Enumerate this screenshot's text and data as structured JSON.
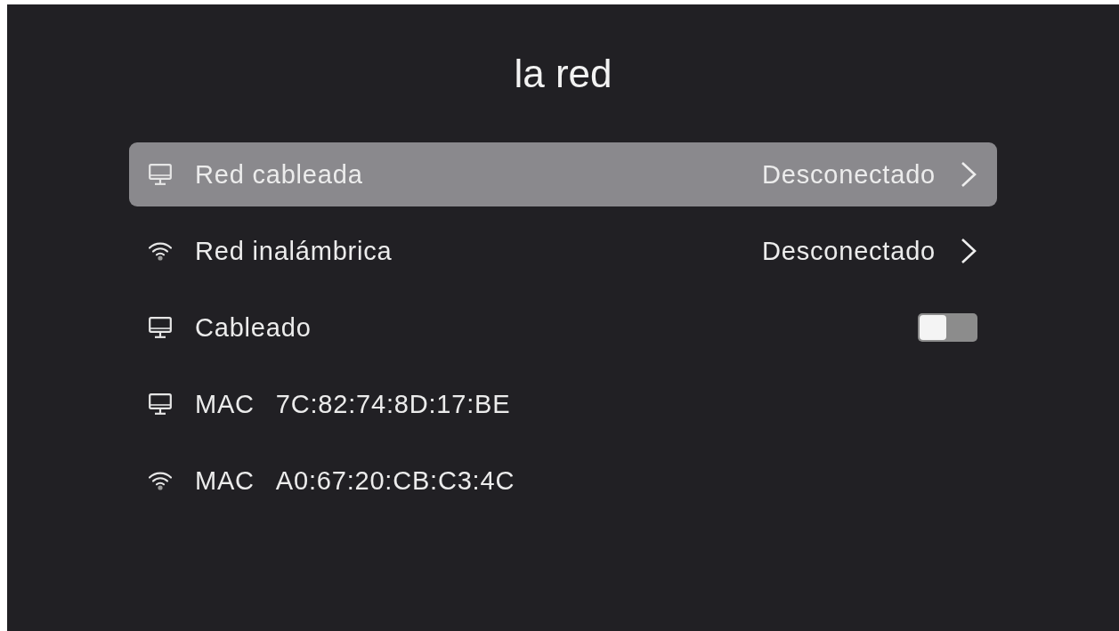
{
  "title": "la red",
  "items": [
    {
      "kind": "link",
      "wireless": false,
      "label": "Red cableada",
      "value": "Desconectado",
      "selected": true
    },
    {
      "kind": "link",
      "wireless": true,
      "label": "Red inalámbrica",
      "value": "Desconectado",
      "selected": false
    },
    {
      "kind": "switch",
      "wireless": false,
      "label": "Cableado",
      "on": false,
      "selected": false
    },
    {
      "kind": "info",
      "wireless": false,
      "label": "MAC",
      "value": "7C:82:74:8D:17:BE",
      "selected": false
    },
    {
      "kind": "info",
      "wireless": true,
      "label": "MAC",
      "value": "A0:67:20:CB:C3:4C",
      "selected": false
    }
  ]
}
